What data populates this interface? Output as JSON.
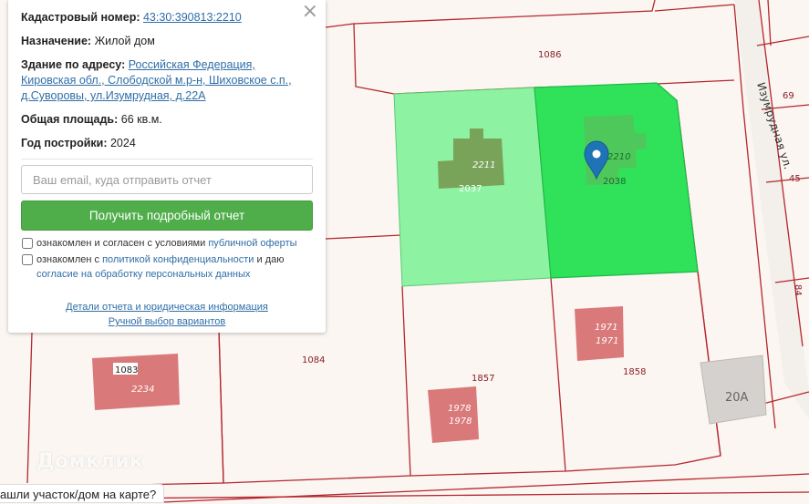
{
  "panel": {
    "cadastral_label": "Кадастровый номер:",
    "cadastral_value": "43:30:390813:2210",
    "purpose_label": "Назначение:",
    "purpose_value": "Жилой дом",
    "address_label": "Здание по адресу:",
    "address_value": "Российская Федерация, Кировская обл., Слободской м.р-н, Шиховское с.п., д.Суворовы, ул.Изумрудная, д.22А",
    "area_label": "Общая площадь:",
    "area_value": "66 кв.м.",
    "year_label": "Год постройки:",
    "year_value": "2024",
    "email_placeholder": "Ваш email, куда отправить отчет",
    "submit_label": "Получить подробный отчет",
    "consent1_text": "ознакомлен и согласен с условиями",
    "consent1_link": "публичной оферты",
    "consent2_text": "ознакомлен с",
    "consent2_link": "политикой конфиденциальности",
    "consent2_mid": "и даю",
    "consent2_link2": "согласие на обработку персональных данных",
    "details_link": "Детали отчета и юридическая информация",
    "manual_link": "Ручной выбор вариантов",
    "close_icon": "×"
  },
  "map": {
    "parcel_labels": [
      "1086",
      "2037",
      "2038",
      "1084",
      "1857",
      "1858",
      "69",
      "45",
      "84"
    ],
    "building_labels": [
      "2211",
      "2210",
      "1083",
      "2234",
      "1971",
      "1971",
      "1978",
      "1978"
    ],
    "road_label": "Изумрудная ул.",
    "house_number": "20А",
    "watermark": "Домклик"
  },
  "bottom": {
    "tip": "ашли участок/дом на карте?"
  },
  "colors": {
    "parcel_line": "#b5262f",
    "selected_parcel": "#2fe25a",
    "neighbor_parcel": "#8ef2a3",
    "building": "#d9797a",
    "button": "#4fae4a",
    "marker": "#1f73b7"
  }
}
